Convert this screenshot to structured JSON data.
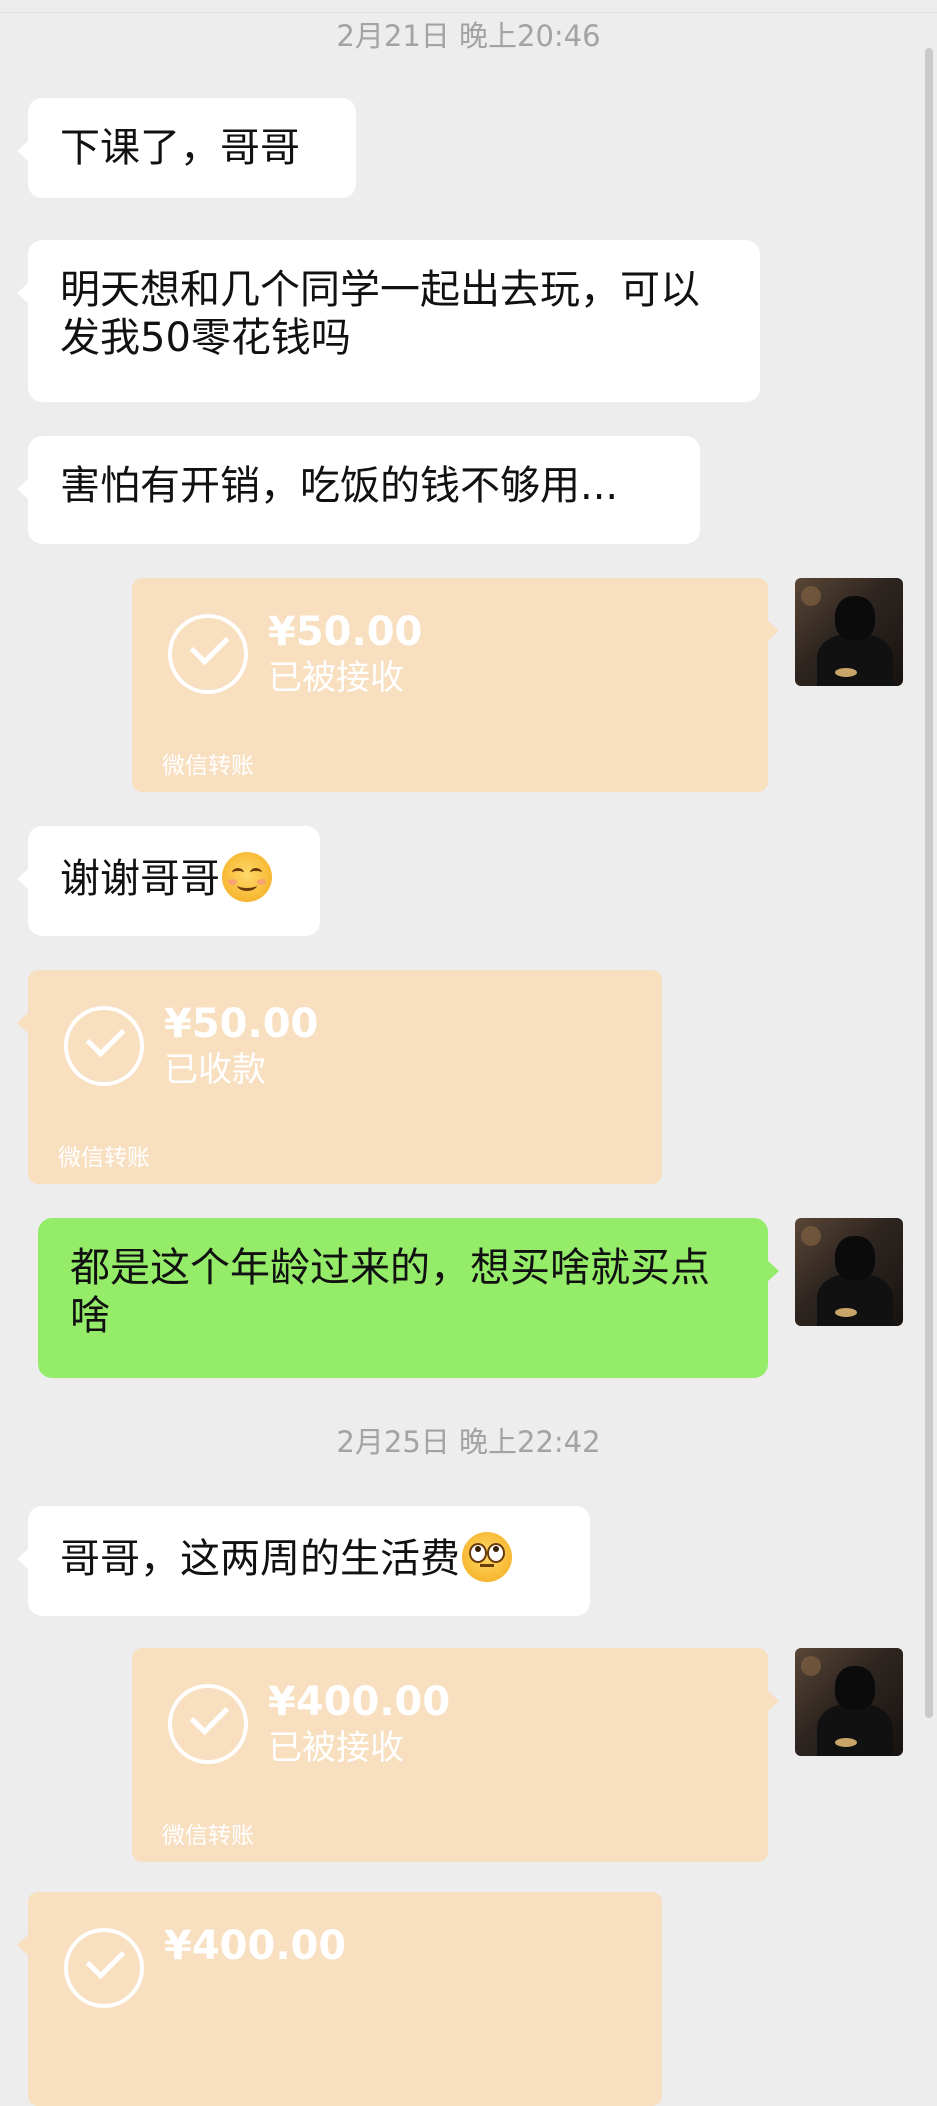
{
  "chat": {
    "timestamps": [
      "2月21日 晚上20:46",
      "2月25日 晚上22:42"
    ],
    "messages": [
      {
        "text": "下课了，哥哥"
      },
      {
        "text": "明天想和几个同学一起出去玩，可以发我50零花钱吗"
      },
      {
        "text": "害怕有开销，吃饭的钱不够用..."
      },
      {
        "text": "谢谢哥哥",
        "emoji": "smiling-face-icon"
      },
      {
        "text": "都是这个年龄过来的，想买啥就买点啥"
      },
      {
        "text": "哥哥，这两周的生活费",
        "emoji": "face-with-rolling-eyes-icon"
      }
    ],
    "transfers": [
      {
        "amount": "¥50.00",
        "status": "已被接收",
        "label": "微信转账"
      },
      {
        "amount": "¥50.00",
        "status": "已收款",
        "label": "微信转账"
      },
      {
        "amount": "¥400.00",
        "status": "已被接收",
        "label": "微信转账"
      },
      {
        "amount": "¥400.00"
      }
    ]
  },
  "colors": {
    "background": "#ededed",
    "incoming_bubble": "#ffffff",
    "outgoing_bubble": "#95ec69",
    "transfer_card": "#f8dfc0",
    "timestamp_text": "#a3a3a3"
  }
}
